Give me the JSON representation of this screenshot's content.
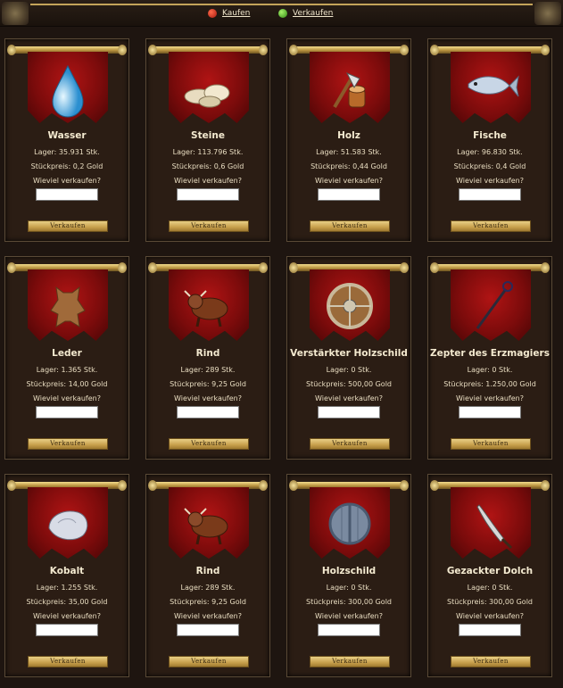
{
  "nav": {
    "buy_label": "Kaufen",
    "sell_label": "Verkaufen",
    "buy_color": "#c0221a",
    "sell_color": "#49b01c"
  },
  "quantity_question": "Wieviel verkaufen?",
  "sell_button_label": "Verkaufen",
  "items": [
    {
      "name": "Wasser",
      "stock": "Lager: 35.931 Stk.",
      "price": "Stückpreis: 0,2 Gold",
      "icon": "water-drop-icon"
    },
    {
      "name": "Steine",
      "stock": "Lager: 113.796 Stk.",
      "price": "Stückpreis: 0,6 Gold",
      "icon": "stones-icon"
    },
    {
      "name": "Holz",
      "stock": "Lager: 51.583 Stk.",
      "price": "Stückpreis: 0,44 Gold",
      "icon": "axe-log-icon"
    },
    {
      "name": "Fische",
      "stock": "Lager: 96.830 Stk.",
      "price": "Stückpreis: 0,4 Gold",
      "icon": "fish-icon"
    },
    {
      "name": "Leder",
      "stock": "Lager: 1.365 Stk.",
      "price": "Stückpreis: 14,00 Gold",
      "icon": "leather-hide-icon"
    },
    {
      "name": "Rind",
      "stock": "Lager: 289 Stk.",
      "price": "Stückpreis: 9,25 Gold",
      "icon": "bull-icon"
    },
    {
      "name": "Verstärkter Holzschild",
      "stock": "Lager: 0 Stk.",
      "price": "Stückpreis: 500,00 Gold",
      "icon": "reinforced-shield-icon"
    },
    {
      "name": "Zepter des Erzmagiers",
      "stock": "Lager: 0 Stk.",
      "price": "Stückpreis: 1.250,00 Gold",
      "icon": "scepter-icon"
    },
    {
      "name": "Kobalt",
      "stock": "Lager: 1.255 Stk.",
      "price": "Stückpreis: 35,00 Gold",
      "icon": "cobalt-ore-icon"
    },
    {
      "name": "Rind",
      "stock": "Lager: 289 Stk.",
      "price": "Stückpreis: 9,25 Gold",
      "icon": "bull-icon"
    },
    {
      "name": "Holzschild",
      "stock": "Lager: 0 Stk.",
      "price": "Stückpreis: 300,00 Gold",
      "icon": "wooden-shield-icon"
    },
    {
      "name": "Gezackter Dolch",
      "stock": "Lager: 0 Stk.",
      "price": "Stückpreis: 300,00 Gold",
      "icon": "jagged-dagger-icon"
    }
  ]
}
